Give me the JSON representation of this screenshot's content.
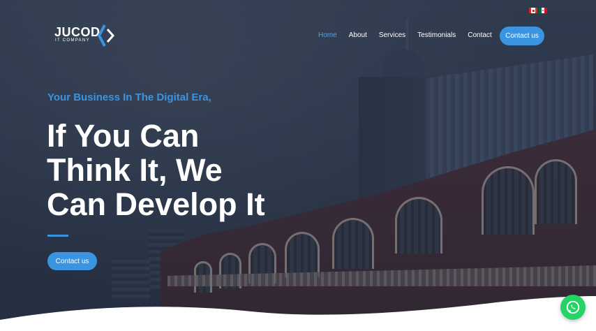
{
  "brand": {
    "name": "JUCOD",
    "subtitle": "IT COMPANY",
    "accent": "#3b94e0"
  },
  "languages": [
    {
      "icon": "canada-flag-icon"
    },
    {
      "icon": "mexico-flag-icon"
    }
  ],
  "nav": {
    "items": [
      {
        "label": "Home",
        "active": true
      },
      {
        "label": "About"
      },
      {
        "label": "Services"
      },
      {
        "label": "Testimonials"
      },
      {
        "label": "Contact"
      }
    ],
    "button_label": "Contact us"
  },
  "hero": {
    "tagline": "Your Business In The Digital Era,",
    "headline": [
      "If You Can",
      "Think It, We",
      "Can Develop It"
    ],
    "cta_label": "Contact us"
  },
  "widgets": {
    "whatsapp_icon": "whatsapp-icon",
    "whatsapp_color": "#25d366"
  }
}
